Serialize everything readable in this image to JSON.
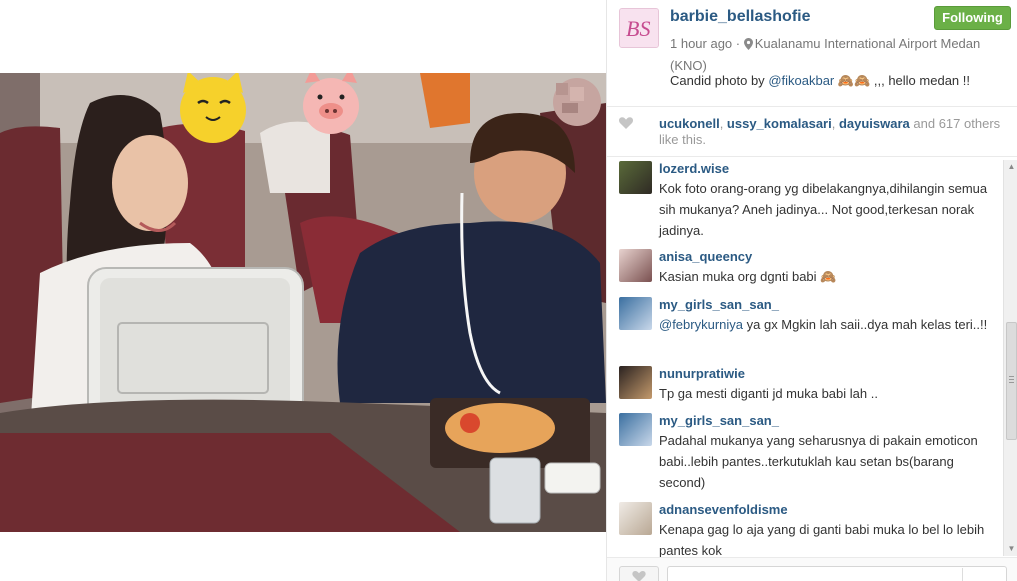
{
  "post": {
    "username": "barbie_bellashofie",
    "follow_label": "Following",
    "time": "1 hour ago",
    "separator": "·",
    "location": "Kualanamu International Airport Medan (KNO)",
    "caption_prefix": "Candid photo by",
    "caption_mention": "@fikoakbar",
    "caption_suffix": "🙈🙈 ,,, hello medan !!"
  },
  "likes": {
    "likers": [
      "ucukonell",
      "ussy_komalasari",
      "dayuiswara"
    ],
    "sep1": ", ",
    "sep2": ", ",
    "and_text": " and ",
    "count": "617",
    "others_text": " others like this."
  },
  "comments": [
    {
      "user": "lozerd.wise",
      "text": "Kok foto orang-orang yg dibelakangnya,dihilangin semua sih mukanya? Aneh jadinya... Not good,terkesan norak jadinya."
    },
    {
      "user": "anisa_queency",
      "text": "Kasian muka org dgnti babi 🙈"
    },
    {
      "user": "my_girls_san_san_",
      "mention": "@febrykurniya",
      "text": " ya gx Mgkin lah saii..dya mah kelas teri..!!"
    },
    {
      "user": "nunurpratiwie",
      "text": "Tp ga mesti diganti jd muka babi lah .."
    },
    {
      "user": "my_girls_san_san_",
      "text": "Padahal mukanya yang seharusnya di pakain emoticon babi..lebih pantes..terkutuklah kau setan bs(barang second)"
    },
    {
      "user": "adnansevenfoldisme",
      "text": "Kenapa gag lo aja yang di ganti babi muka lo bel lo lebih pantes kok"
    }
  ],
  "footer": {
    "comment_placeholder": ""
  },
  "icons": {
    "location": "map-pin-icon",
    "heart": "heart-icon",
    "scroll_up": "scroll-up-arrow-icon",
    "scroll_down": "scroll-down-arrow-icon"
  },
  "colors": {
    "link": "#2b5a83",
    "follow_bg": "#6bb047"
  }
}
